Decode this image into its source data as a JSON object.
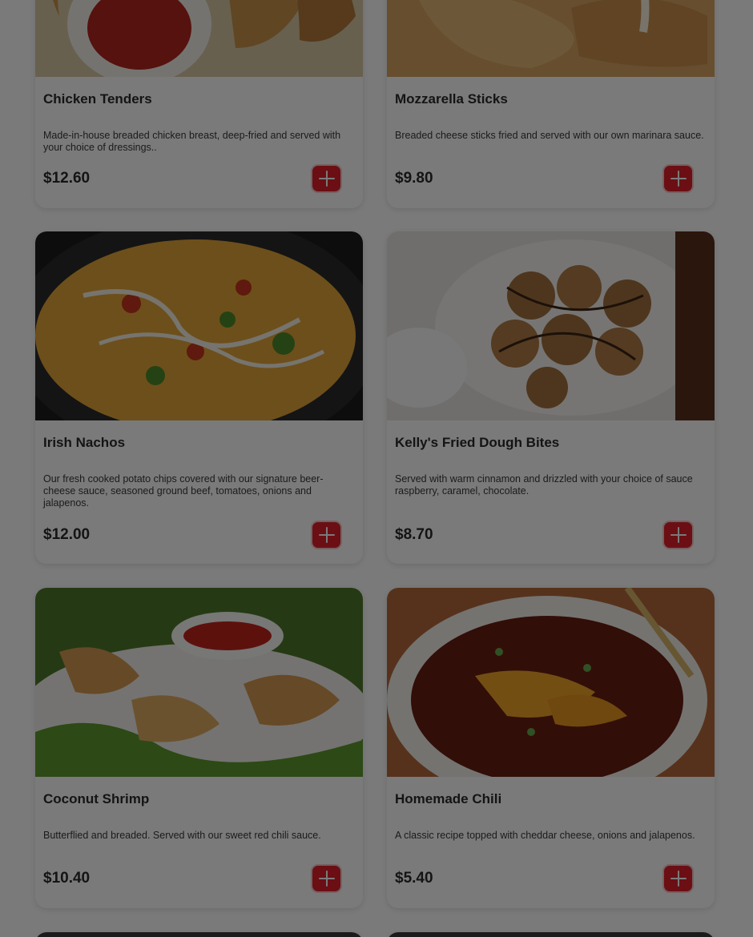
{
  "menu": {
    "items": [
      {
        "title": "Chicken Tenders",
        "description": "Made-in-house breaded chicken breast, deep-fried and served with your choice of dressings..",
        "price": "$12.60",
        "photo": "chicken-tenders-photo"
      },
      {
        "title": "Mozzarella Sticks",
        "description": "Breaded cheese sticks fried and served with our own marinara sauce.",
        "price": "$9.80",
        "photo": "mozzarella-sticks-photo"
      },
      {
        "title": "Irish Nachos",
        "description": "Our fresh cooked potato chips covered with our signature beer-cheese sauce, seasoned ground beef, tomatoes, onions and jalapenos.",
        "price": "$12.00",
        "photo": "irish-nachos-photo"
      },
      {
        "title": "Kelly's Fried Dough Bites",
        "description": "Served with warm cinnamon and drizzled with your choice of sauce raspberry, caramel, chocolate.",
        "price": "$8.70",
        "photo": "fried-dough-bites-photo"
      },
      {
        "title": "Coconut Shrimp",
        "description": "Butterflied and breaded. Served with our sweet red chili sauce.",
        "price": "$10.40",
        "photo": "coconut-shrimp-photo"
      },
      {
        "title": "Homemade Chili",
        "description": "A classic recipe topped with cheddar cheese, onions and jalapenos.",
        "price": "$5.40",
        "photo": "homemade-chili-photo"
      }
    ],
    "add_icon": "plus-icon",
    "colors": {
      "accent": "#e0202a",
      "overlay": "rgba(0,0,0,0.52)"
    }
  }
}
